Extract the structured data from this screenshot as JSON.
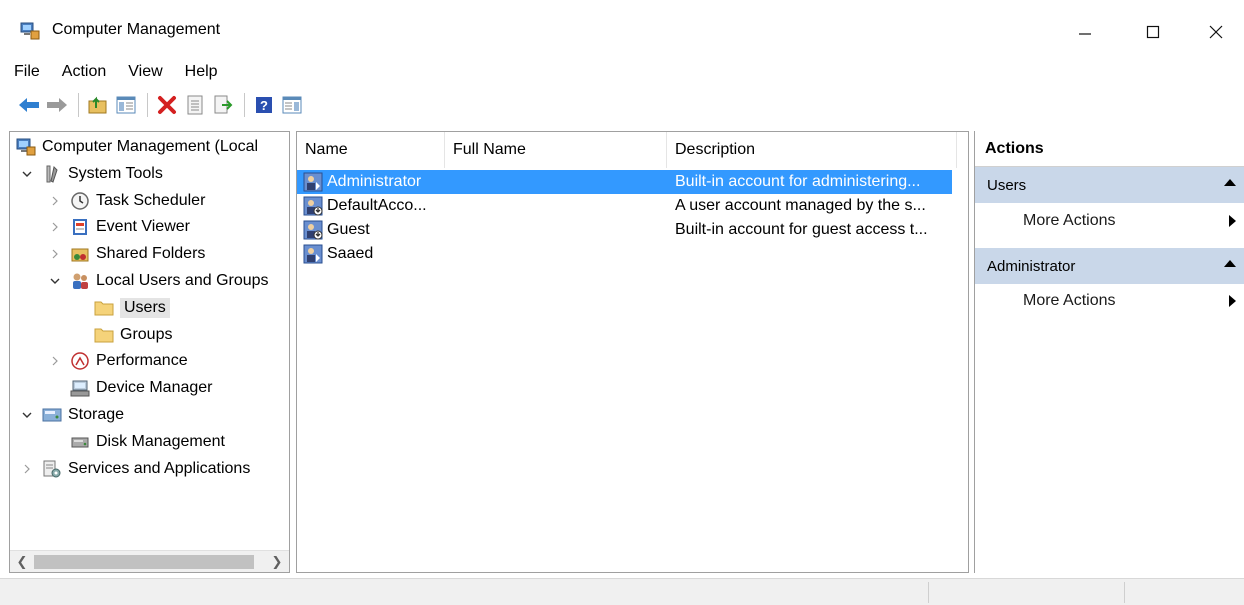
{
  "window": {
    "title": "Computer Management"
  },
  "menu": [
    "File",
    "Action",
    "View",
    "Help"
  ],
  "tree": [
    {
      "label": "Computer Management (Local",
      "icon": "computer-management-icon",
      "expander": "none"
    },
    {
      "label": "System Tools",
      "icon": "system-tools-icon",
      "expander": "expanded"
    },
    {
      "label": "Task Scheduler",
      "icon": "clock-icon",
      "expander": "collapsed"
    },
    {
      "label": "Event Viewer",
      "icon": "event-viewer-icon",
      "expander": "collapsed"
    },
    {
      "label": "Shared Folders",
      "icon": "shared-folders-icon",
      "expander": "collapsed"
    },
    {
      "label": "Local Users and Groups",
      "icon": "users-groups-icon",
      "expander": "expanded"
    },
    {
      "label": "Users",
      "icon": "folder-icon",
      "expander": "none"
    },
    {
      "label": "Groups",
      "icon": "folder-icon",
      "expander": "none"
    },
    {
      "label": "Performance",
      "icon": "performance-icon",
      "expander": "collapsed"
    },
    {
      "label": "Device Manager",
      "icon": "device-manager-icon",
      "expander": "none"
    },
    {
      "label": "Storage",
      "icon": "storage-icon",
      "expander": "expanded"
    },
    {
      "label": "Disk Management",
      "icon": "disk-icon",
      "expander": "none"
    },
    {
      "label": "Services and Applications",
      "icon": "services-icon",
      "expander": "collapsed"
    }
  ],
  "list": {
    "columns": [
      "Name",
      "Full Name",
      "Description"
    ],
    "rows": [
      {
        "name": "Administrator",
        "full_name": "",
        "description": "Built-in account for administering...",
        "selected": true
      },
      {
        "name": "DefaultAcco...",
        "full_name": "",
        "description": "A user account managed by the s...",
        "selected": false
      },
      {
        "name": "Guest",
        "full_name": "",
        "description": "Built-in account for guest access t...",
        "selected": false
      },
      {
        "name": "Saaed",
        "full_name": "",
        "description": "",
        "selected": false
      }
    ]
  },
  "actions": {
    "title": "Actions",
    "groups": [
      {
        "label": "Users",
        "items": [
          "More Actions"
        ]
      },
      {
        "label": "Administrator",
        "items": [
          "More Actions"
        ]
      }
    ]
  },
  "colors": {
    "selection": "#3399ff",
    "actions_group_bg": "#c9d7e9"
  }
}
